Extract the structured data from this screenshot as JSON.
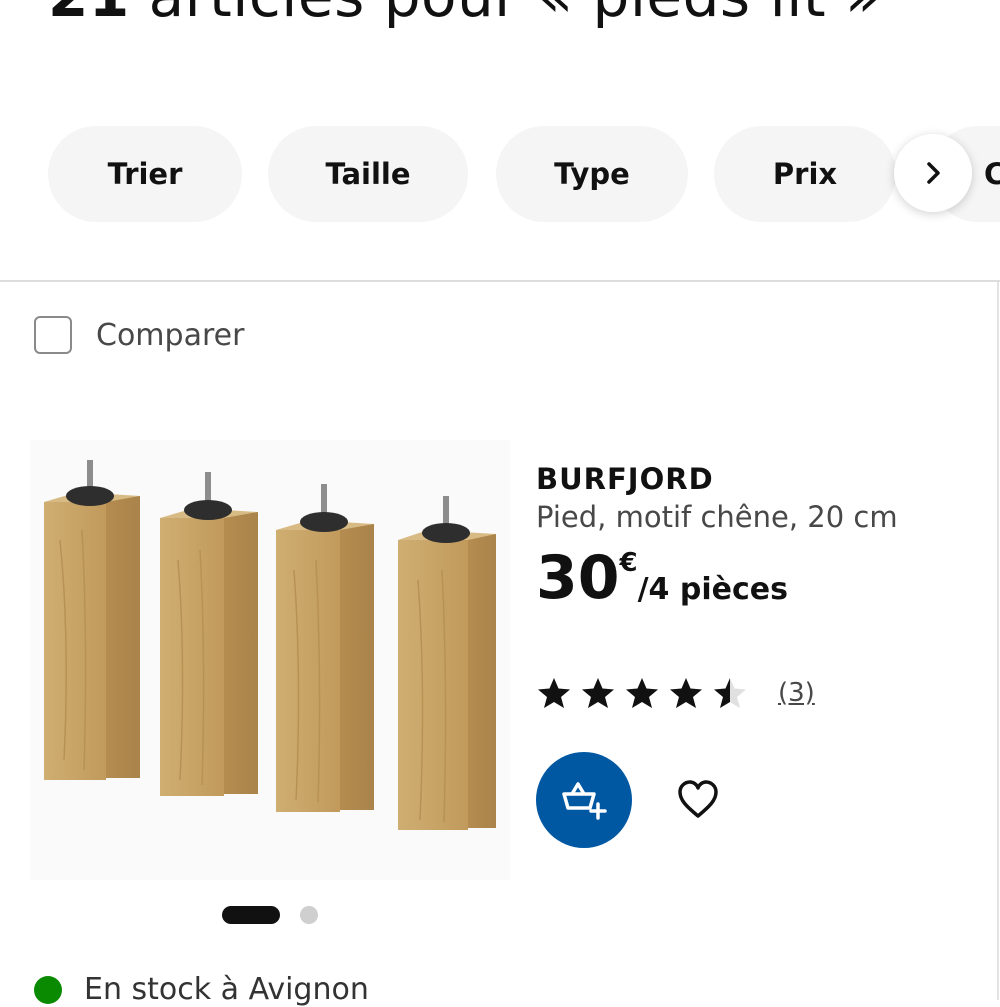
{
  "header": {
    "count": "21",
    "title_rest": " articles pour « pieds lit »"
  },
  "filters": [
    {
      "label": "Trier"
    },
    {
      "label": "Taille"
    },
    {
      "label": "Type"
    },
    {
      "label": "Prix"
    },
    {
      "label": "C"
    }
  ],
  "compare": {
    "label": "Comparer",
    "checked": false
  },
  "product": {
    "name": "BURFJORD",
    "description": "Pied, motif chêne, 20 cm",
    "price_int": "30",
    "currency": "€",
    "price_unit": "/4 pièces",
    "rating": 4.5,
    "max_rating": 5,
    "review_count": "(3)",
    "image_count": 2,
    "active_image": 1
  },
  "stock": {
    "text": "En stock à Avignon",
    "color": "#0a8a00"
  },
  "colors": {
    "brand_blue": "#0058a3",
    "pill_bg": "#f5f5f5",
    "wood": "#c9a468"
  },
  "icons": {
    "scroll": "chevron-right-icon",
    "cart": "add-to-cart-icon",
    "favorite": "heart-icon",
    "star": "star-icon"
  }
}
